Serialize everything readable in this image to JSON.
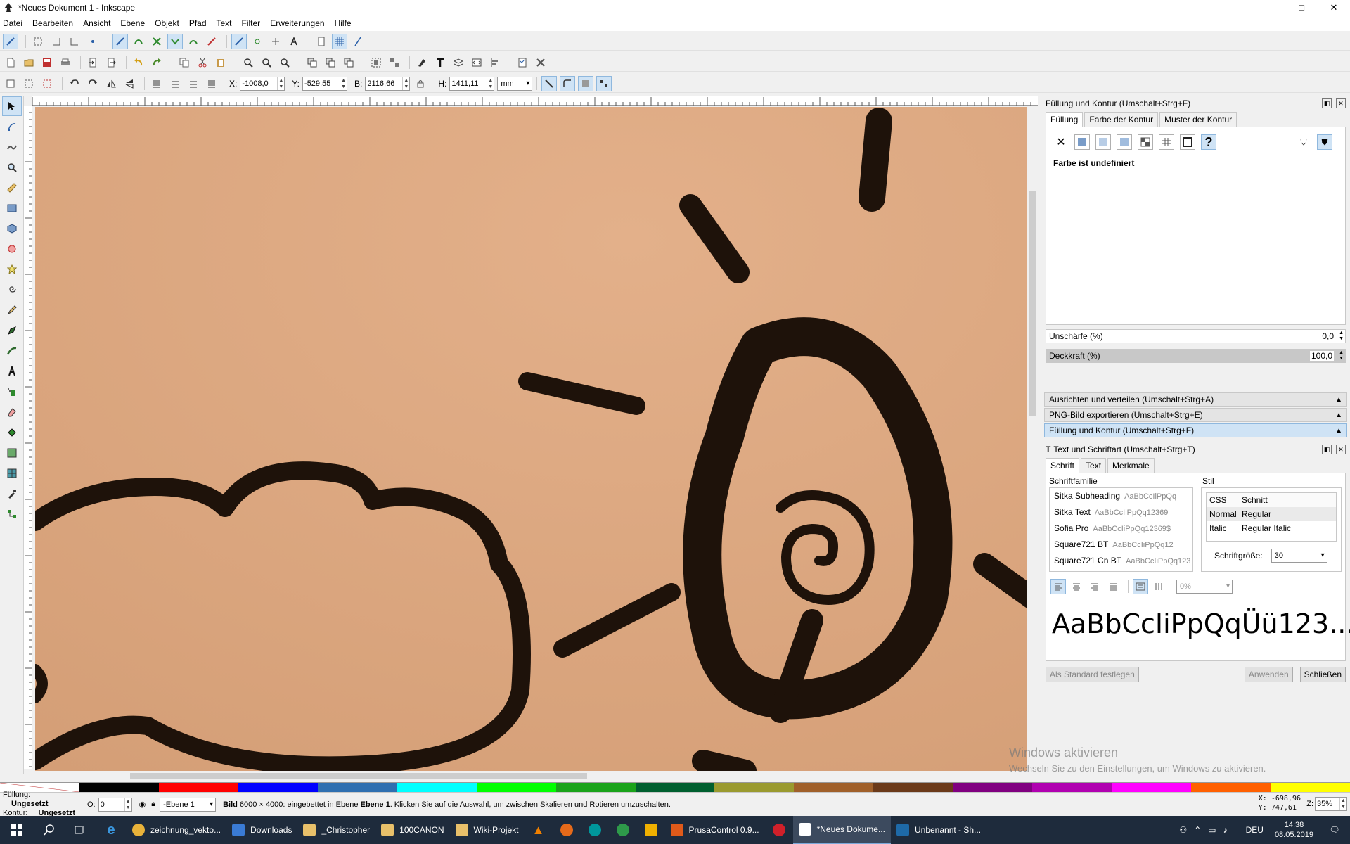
{
  "window": {
    "title": "*Neues Dokument 1 - Inkscape",
    "controls": [
      "–",
      "□",
      "✕"
    ]
  },
  "menu": [
    "Datei",
    "Bearbeiten",
    "Ansicht",
    "Ebene",
    "Objekt",
    "Pfad",
    "Text",
    "Filter",
    "Erweiterungen",
    "Hilfe"
  ],
  "coords": {
    "x_label": "X:",
    "x_value": "-1008,0",
    "y_label": "Y:",
    "y_value": "-529,55",
    "w_label": "B:",
    "w_value": "2116,66",
    "h_label": "H:",
    "h_value": "1411,11",
    "unit": "mm"
  },
  "fill_stroke": {
    "title": "Füllung und Kontur (Umschalt+Strg+F)",
    "tabs": [
      "Füllung",
      "Farbe der Kontur",
      "Muster der Kontur"
    ],
    "status": "Farbe ist undefiniert",
    "blur_label": "Unschärfe (%)",
    "blur_value": "0,0",
    "opacity_label": "Deckkraft (%)",
    "opacity_value": "100,0"
  },
  "collapsed_panels": [
    "Ausrichten und verteilen (Umschalt+Strg+A)",
    "PNG-Bild exportieren (Umschalt+Strg+E)",
    "Füllung und Kontur (Umschalt+Strg+F)"
  ],
  "text_font": {
    "title": "Text und Schriftart (Umschalt+Strg+T)",
    "tabs": [
      "Schrift",
      "Text",
      "Merkmale"
    ],
    "family_label": "Schriftfamilie",
    "style_label": "Stil",
    "fonts": [
      {
        "name": "Sitka Subheading",
        "preview": "AaBbCcIiPpQq"
      },
      {
        "name": "Sitka Text",
        "preview": "AaBbCcIiPpQq12369"
      },
      {
        "name": "Sofia Pro",
        "preview": "AaBbCcIiPpQq12369$"
      },
      {
        "name": "Square721 BT",
        "preview": "AaBbCcIiPpQq12"
      },
      {
        "name": "Square721 Cn BT",
        "preview": "AaBbCcIiPpQq123"
      }
    ],
    "styles_header": {
      "css": "CSS",
      "face": "Schnitt"
    },
    "styles": [
      {
        "css": "Normal",
        "face": "Regular"
      },
      {
        "css": "Italic",
        "face": "Regular Italic"
      }
    ],
    "size_label": "Schriftgröße:",
    "size_value": "30",
    "spacing_value": "0%",
    "preview": "AaBbCcIiPpQqÜü123...",
    "btn_default": "Als Standard festlegen",
    "btn_apply": "Anwenden",
    "btn_close": "Schließen"
  },
  "statusbar": {
    "fill_label": "Füllung:",
    "fill_value": "Ungesetzt",
    "stroke_label": "Kontur:",
    "stroke_value": "Ungesetzt",
    "o_label": "O:",
    "o_value": "0",
    "layer": "-Ebene 1",
    "message_bold": "Bild",
    "message": " 6000 × 4000: eingebettet in Ebene ",
    "message_layer": "Ebene 1",
    "message_tail": ". Klicken Sie auf die Auswahl, um zwischen Skalieren und Rotieren umzuschalten.",
    "cursor_x": "X: -698,96",
    "cursor_y": "Y:  747,61",
    "zoom_label": "Z:",
    "zoom_value": "35%"
  },
  "watermark": {
    "title": "Windows aktivieren",
    "sub": "Wechseln Sie zu den Einstellungen, um Windows zu aktivieren."
  },
  "taskbar": {
    "items": [
      "zeichnung_vekto...",
      "Downloads",
      "_Christopher",
      "100CANON",
      "Wiki-Projekt",
      "PrusaControl 0.9...",
      "*Neues Dokume...",
      "Unbenannt - Sh..."
    ],
    "lang": "DEU",
    "time": "14:38",
    "date": "08.05.2019"
  },
  "palette": [
    "#ffffff",
    "#000000",
    "#ff0000",
    "#0000ff",
    "#2f6fb0",
    "#00ffff",
    "#00ff00",
    "#1aa31a",
    "#005f2f",
    "#9a9a2f",
    "#a0602a",
    "#6b3a1a",
    "#800080",
    "#b000b0",
    "#ff00ff",
    "#ff6000",
    "#ffff00"
  ]
}
